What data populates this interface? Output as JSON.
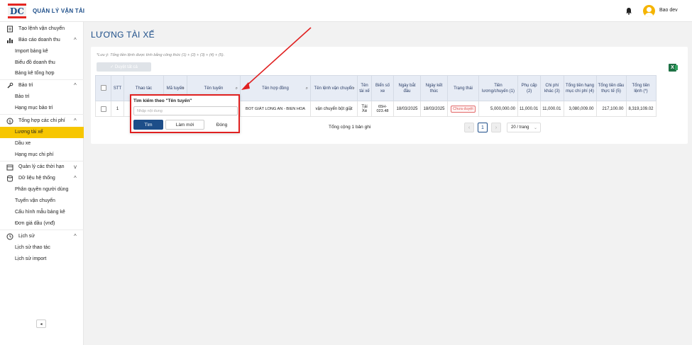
{
  "app": {
    "title": "QUẢN LÝ VẬN TẢI",
    "logo_text": "DC",
    "user_name": "Bao dev"
  },
  "sidebar": {
    "groups": [
      {
        "label": "Tạo lệnh vận chuyển",
        "icon": "document-icon",
        "chevron": ""
      },
      {
        "label": "Báo cáo doanh thu",
        "icon": "bar-chart-icon",
        "chevron": "^"
      },
      {
        "label": "Bảo trì",
        "icon": "wrench-icon",
        "chevron": "^"
      },
      {
        "label": "Tổng hợp các chi phí",
        "icon": "dollar-icon",
        "chevron": "^"
      },
      {
        "label": "Quản lý các thời hạn",
        "icon": "calendar-icon",
        "chevron": "v"
      },
      {
        "label": "Dữ liệu hệ thống",
        "icon": "database-icon",
        "chevron": "^"
      },
      {
        "label": "Lịch sử",
        "icon": "history-icon",
        "chevron": "^"
      }
    ],
    "items": [
      {
        "label": "Import bảng kê"
      },
      {
        "label": "Biểu đồ doanh thu"
      },
      {
        "label": "Bảng kê tổng hợp"
      },
      {
        "label": "Bảo trì"
      },
      {
        "label": "Hạng mục bảo trì"
      },
      {
        "label": "Lương tài xế"
      },
      {
        "label": "Dầu xe"
      },
      {
        "label": "Hạng mục chi phí"
      },
      {
        "label": "Phân quyền người dùng"
      },
      {
        "label": "Tuyến vận chuyển"
      },
      {
        "label": "Cấu hình mẫu bảng kê"
      },
      {
        "label": "Đơn giá dầu (vnđ)"
      },
      {
        "label": "Lịch sử thao tác"
      },
      {
        "label": "Lịch sử import"
      }
    ],
    "collapse_label": "◂"
  },
  "main": {
    "page_title": "LƯƠNG TÀI XẾ",
    "note": "*Lưu ý: Tổng tiền lệnh được tính bằng công thức (1) + (2) + (3) + (4) + (5).",
    "approve_all_label": "✓  Duyệt tất cả",
    "excel_label": "X"
  },
  "table": {
    "headers": [
      "STT",
      "Thao tác",
      "Mã tuyến",
      "Tên tuyến",
      "Tên hợp đồng",
      "Tên lệnh vận chuyển",
      "Tên tài xế",
      "Biển số xe",
      "Ngày bắt đầu",
      "Ngày kết thúc",
      "Trạng thái",
      "Tiền lương/chuyến (1)",
      "Phụ cấp (2)",
      "Chi phí khác (3)",
      "Tổng tiền hạng mục chi phí (4)",
      "Tổng tiền dầu thực tế (5)",
      "Tổng tiền lệnh (*)"
    ],
    "row": {
      "stt": "1",
      "contract": "BOT GIÁT LONG AN - BIEN HOA",
      "order": "vận chuyển bột giặt",
      "driver": "Tài Xe",
      "plate": "65H-023.48",
      "start": "18/03/2025",
      "end": "18/03/2025",
      "status": "Chưa duyệt",
      "salary": "5,000,000.00",
      "allowance": "11,000.01",
      "other": "11,000.01",
      "category_total": "3,080,009.00",
      "fuel_total": "217,100.00",
      "order_total": "8,319,109.02"
    }
  },
  "pagination": {
    "total": "Tổng cộng 1 bản ghi",
    "prev": "‹",
    "page": "1",
    "next": "›",
    "page_size": "20 / trang",
    "size_chevron": "⌄"
  },
  "popup": {
    "title": "Tìm kiếm theo \"Tên tuyến\"",
    "placeholder": "Nhập nội dung",
    "search_label": "Tìm",
    "reset_label": "Làm mới",
    "close_label": "Đóng"
  },
  "colors": {
    "accent": "#1d4e89",
    "active": "#f7c600",
    "highlight": "#e02020"
  }
}
